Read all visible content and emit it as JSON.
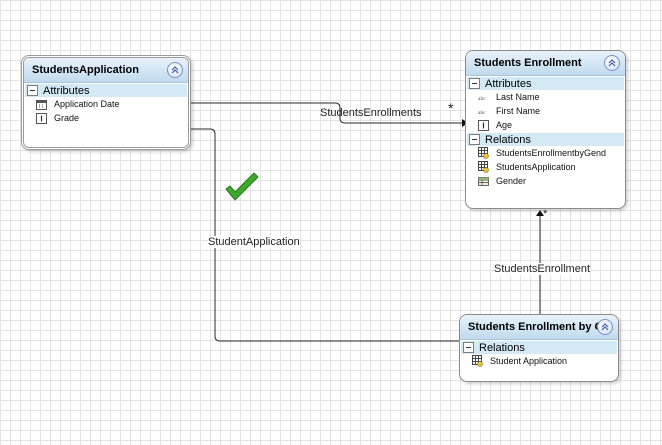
{
  "entities": {
    "students_application": {
      "title": "StudentsApplication",
      "attributes_label": "Attributes",
      "attributes": [
        "Application Date",
        "Grade"
      ]
    },
    "students_enrollment": {
      "title": "Students Enrollment",
      "attributes_label": "Attributes",
      "attributes": [
        "Last Name",
        "First Name",
        "Age"
      ],
      "relations_label": "Relations",
      "relations": [
        "StudentsEnrollmentbyGend",
        "StudentsApplication",
        "Gender"
      ]
    },
    "students_enrollment_by_gender": {
      "title": "Students Enrollment by Gender",
      "relations_label": "Relations",
      "relations": [
        "Student Application"
      ]
    }
  },
  "connectors": {
    "students_enrollments": {
      "label": "StudentsEnrollments",
      "multiplicity": "*"
    },
    "student_application": {
      "label": "StudentApplication"
    },
    "students_enrollment": {
      "label": "StudentsEnrollment",
      "multiplicity": "*"
    }
  },
  "icons": {
    "date": "calendar-icon",
    "integer": "numeric-icon",
    "string": "text-abc-icon",
    "relation": "relation-grid-icon",
    "lookup": "table-icon",
    "validated": "green-checkmark-icon"
  },
  "colors": {
    "header_gradient_top": "#e8f3fb",
    "header_gradient_bottom": "#bfdaee",
    "section_bg": "#d3eaf4",
    "check_green": "#3ea82c"
  }
}
